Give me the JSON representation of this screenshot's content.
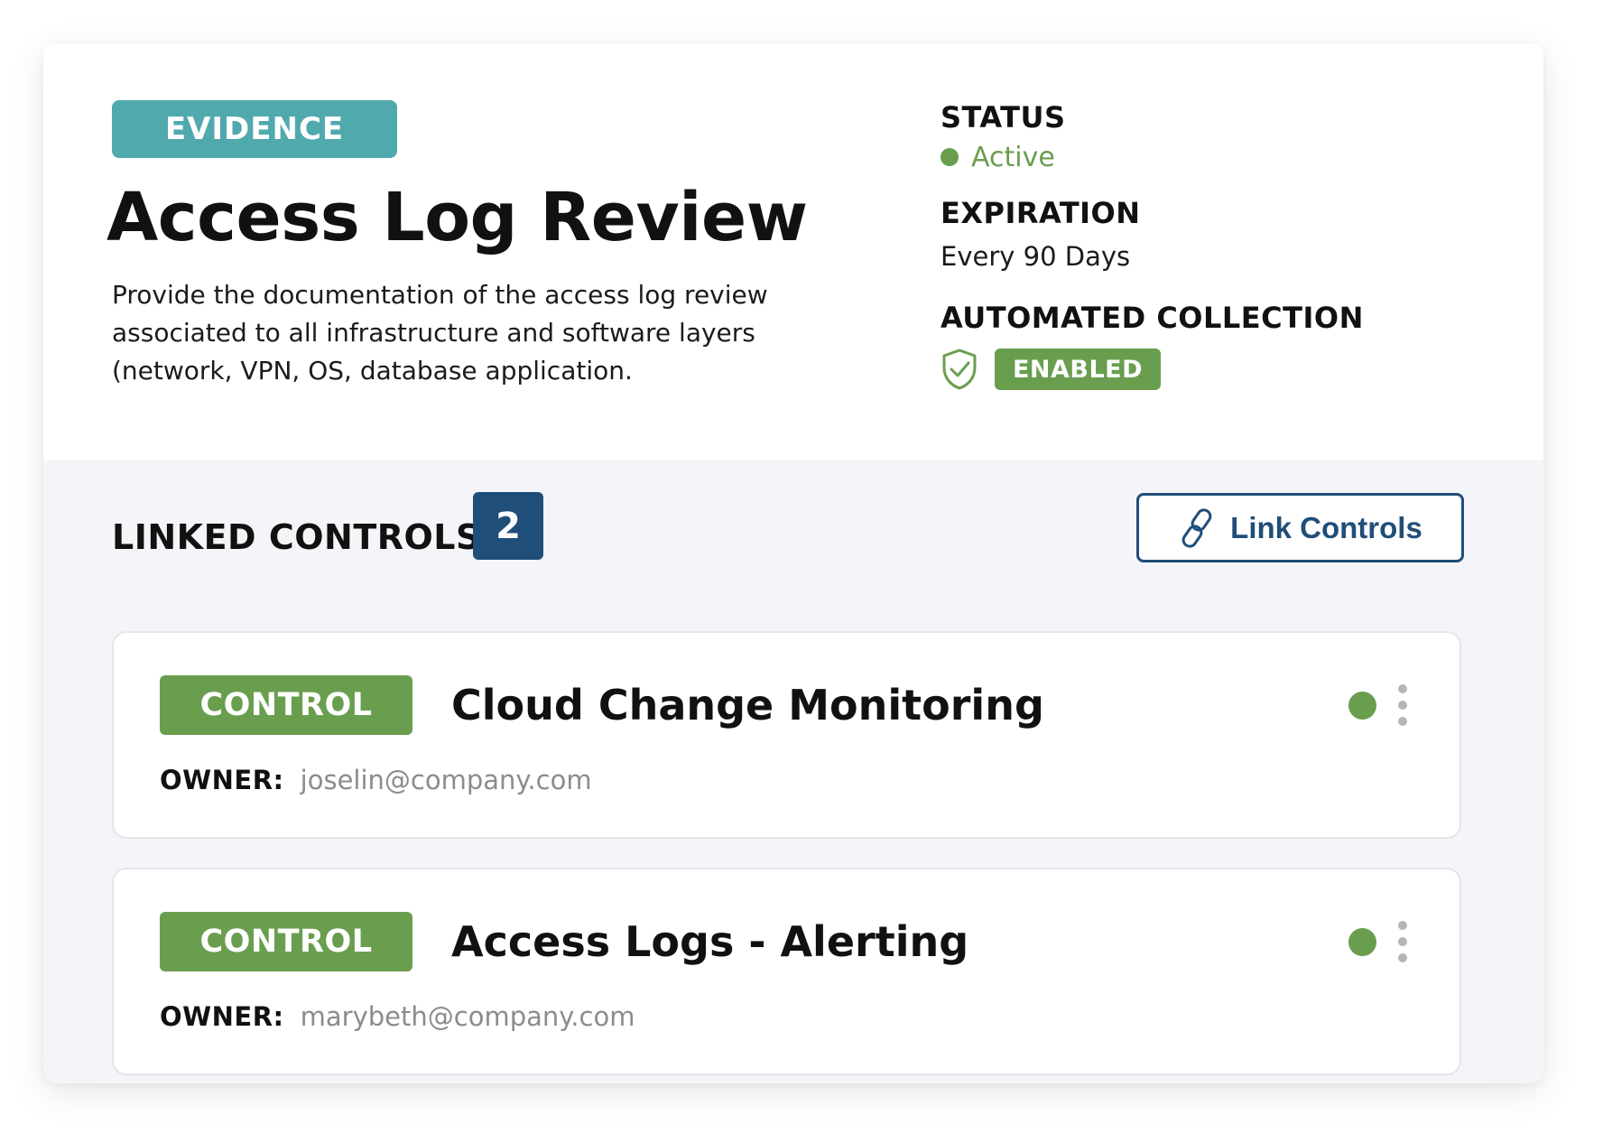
{
  "evidence": {
    "tag": "EVIDENCE",
    "title": "Access Log Review",
    "description": "Provide the documentation of the access log review associated to all infrastructure and software layers (network, VPN, OS, database application."
  },
  "meta": {
    "status_label": "STATUS",
    "status_value": "Active",
    "expiration_label": "EXPIRATION",
    "expiration_value": "Every 90 Days",
    "automated_label": "AUTOMATED COLLECTION",
    "automated_value": "ENABLED",
    "automated_icon": "shield-check-icon"
  },
  "linked": {
    "title": "LINKED CONTROLS",
    "count": "2",
    "button_label": "Link Controls",
    "button_icon": "link-icon"
  },
  "controls": [
    {
      "tag": "CONTROL",
      "title": "Cloud Change Monitoring",
      "owner_label": "OWNER:",
      "owner_email": "joselin@company.com",
      "status": "active"
    },
    {
      "tag": "CONTROL",
      "title": "Access Logs - Alerting",
      "owner_label": "OWNER:",
      "owner_email": "marybeth@company.com",
      "status": "active"
    }
  ],
  "colors": {
    "teal": "#4fa9ad",
    "green": "#6a9e4f",
    "navy": "#1f4e79",
    "section_bg": "#f3f5f8",
    "muted_text": "#8c8c8c"
  }
}
